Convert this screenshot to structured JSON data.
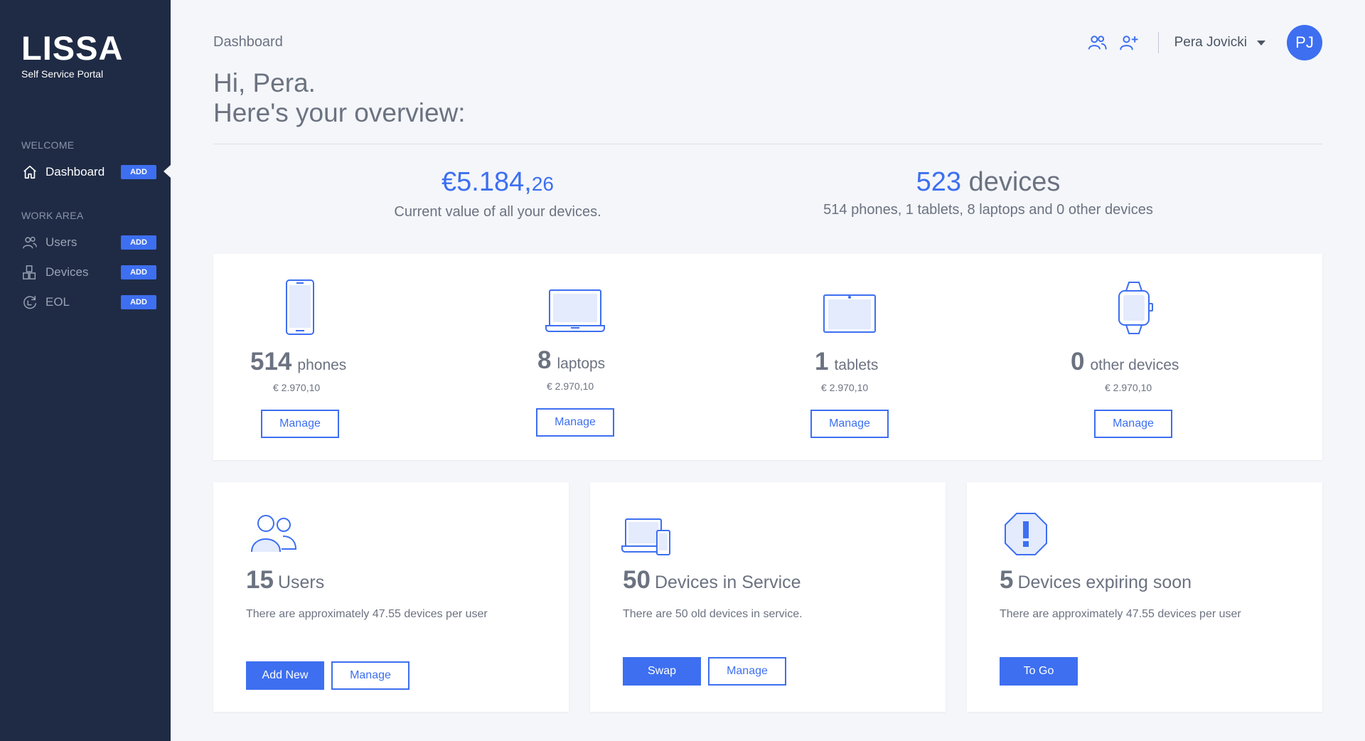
{
  "brand": {
    "name": "LISSA",
    "subtitle": "Self Service Portal"
  },
  "sidebar": {
    "sections": [
      {
        "label": "WELCOME",
        "items": [
          {
            "label": "Dashboard",
            "badge": "ADD",
            "icon": "home-icon",
            "active": true
          }
        ]
      },
      {
        "label": "WORK AREA",
        "items": [
          {
            "label": "Users",
            "badge": "ADD",
            "icon": "users-icon"
          },
          {
            "label": "Devices",
            "badge": "ADD",
            "icon": "devices-icon"
          },
          {
            "label": "EOL",
            "badge": "ADD",
            "icon": "eol-icon"
          }
        ]
      }
    ]
  },
  "header": {
    "breadcrumb": "Dashboard",
    "greeting_line1": "Hi, Pera.",
    "greeting_line2": "Here's your overview:",
    "user_name": "Pera Jovicki",
    "avatar_initials": "PJ",
    "icons": [
      "users-icon",
      "add-user-icon"
    ]
  },
  "summary": {
    "value_main": "€5.184,",
    "value_cents": "26",
    "value_caption": "Current value of all your devices.",
    "devices_count": "523",
    "devices_word": "devices",
    "devices_caption": "514 phones, 1 tablets, 8 laptops and 0 other devices"
  },
  "device_types": [
    {
      "count": "514",
      "label": "phones",
      "price": "€ 2.970,10",
      "button": "Manage",
      "icon": "phone-icon"
    },
    {
      "count": "8",
      "label": "laptops",
      "price": "€ 2.970,10",
      "button": "Manage",
      "icon": "laptop-icon"
    },
    {
      "count": "1",
      "label": "tablets",
      "price": "€ 2.970,10",
      "button": "Manage",
      "icon": "tablet-icon"
    },
    {
      "count": "0",
      "label": "other devices",
      "price": "€ 2.970,10",
      "button": "Manage",
      "icon": "smartwatch-icon"
    }
  ],
  "cards": [
    {
      "count": "15",
      "title": "Users",
      "desc": "There are approximately 47.55 devices per user",
      "primary": "Add New",
      "secondary": "Manage",
      "icon": "users-icon"
    },
    {
      "count": "50",
      "title": "Devices in Service",
      "desc": "There are 50 old devices in service.",
      "primary": "Swap",
      "secondary": "Manage",
      "icon": "devices-in-service-icon"
    },
    {
      "count": "5",
      "title": "Devices expiring soon",
      "desc": "There are approximately 47.55 devices per user",
      "primary": "To Go",
      "icon": "alert-icon"
    }
  ],
  "colors": {
    "sidebar": "#1f2b45",
    "accent": "#3d6ff0",
    "background": "#f4f6fa",
    "text": "#6b7280"
  }
}
